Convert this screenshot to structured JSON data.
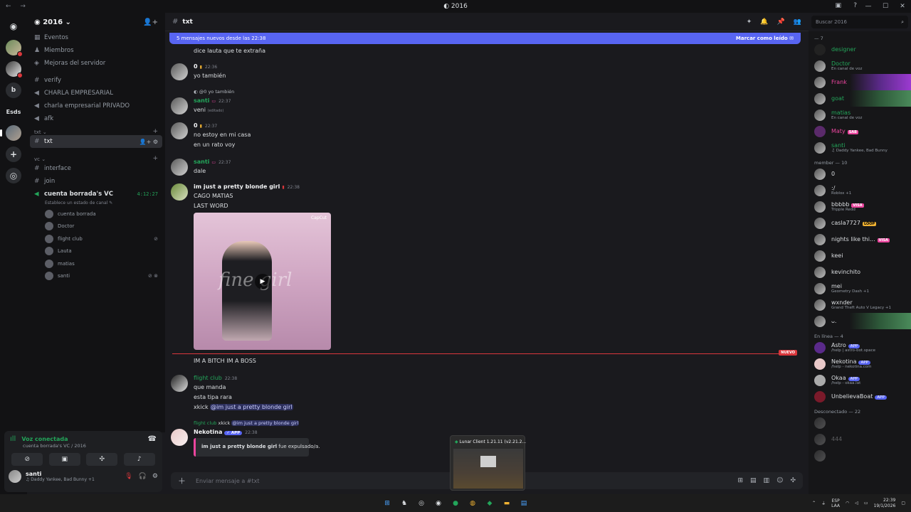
{
  "window": {
    "title": "2016",
    "nav_back": "←",
    "nav_forward": "→",
    "controls": [
      "—",
      "☐",
      "✕"
    ]
  },
  "servers": {
    "discord_glyph": "◉",
    "items": [
      {
        "label": "",
        "type": "av1"
      },
      {
        "label": "",
        "type": "av2"
      },
      {
        "label": "b",
        "type": "plain"
      },
      {
        "label": "Esds",
        "type": "txt"
      },
      {
        "label": "",
        "type": "av3"
      },
      {
        "label": "+",
        "type": "add"
      },
      {
        "label": "◎",
        "type": "add"
      }
    ]
  },
  "sidebar": {
    "server_name": "2016",
    "top_items": [
      "Eventos",
      "Miembros",
      "Mejoras del servidor"
    ],
    "channels_a": [
      "verify",
      "CHARLA EMPRESARIAL",
      "charla empresarial PRIVADO",
      "afk"
    ],
    "cat_txt": "txt",
    "active_channel": "txt",
    "cat_vc": "vc",
    "voice_channels": [
      "interface",
      "join"
    ],
    "vc_active": {
      "name": "cuenta borrada's VC",
      "time": "4:12:27",
      "status": "Establece un estado de canal ✎"
    },
    "vc_users": [
      "cuenta borrada",
      "Doctor",
      "flight club",
      "Lauta",
      "matias",
      "santi"
    ]
  },
  "voice_panel": {
    "title": "Voz conectada",
    "sub": "cuenta borrada's VC / 2016",
    "user_name": "santi",
    "user_status": "♫ Daddy Yankee, Bad Bunny +1"
  },
  "chat": {
    "channel": "txt",
    "new_messages": "5 mensajes nuevos desde las 22:38",
    "mark_read": "Marcar como leído",
    "composer_placeholder": "Enviar mensaje a #txt",
    "messages": {
      "m0_line": "dice lauta que te extraña",
      "m1_name": "0",
      "m1_time": "22:36",
      "m1_line": "yo también",
      "m2_reply": "@0 yo también",
      "m2_name": "santi",
      "m2_time": "22:37",
      "m2_line": "veni",
      "m2_edited": "(editado)",
      "m3_name": "0",
      "m3_time": "22:37",
      "m3_line1": "no estoy en mi casa",
      "m3_line2": "en un rato voy",
      "m4_name": "santi",
      "m4_time": "22:37",
      "m4_line": "dale",
      "m5_name": "im just a pretty blonde girl",
      "m5_time": "22:38",
      "m5_line1": "CAGO MATIAS",
      "m5_line2": "LAST WORD",
      "media_watermark": "fine girl",
      "media_caption": "CapCut",
      "m6_line": "IM A BITCH IM A BOSS",
      "new_label": "NUEVO",
      "m7_name": "flight club",
      "m7_time": "22:38",
      "m7_line1": "que manda",
      "m7_line2": "esta tipa rara",
      "m7_line3": "xkick",
      "m7_mention": "@im just a pretty blonde girl",
      "m8_reply_user": "flight club",
      "m8_reply_cmd": "xkick",
      "m8_reply_mention": "@im just a pretty blonde girl",
      "m8_name": "Nekotina",
      "m8_app": "APP",
      "m8_time": "22:38",
      "m8_embed_bold": "im just a pretty blonde girl",
      "m8_embed_rest": "fue expulsado/a."
    }
  },
  "popup": {
    "title": "Lunar Client 1.21.11 (v2.21.2..."
  },
  "members": {
    "search": "Buscar 2016",
    "group_top": "— 7",
    "top": [
      {
        "name": "designer",
        "color": "#23a55a",
        "sub": ""
      },
      {
        "name": "Doctor",
        "color": "#23a55a",
        "sub": "En canal de voz"
      },
      {
        "name": "Frank",
        "color": "#eb459e",
        "sub": ""
      },
      {
        "name": "goat",
        "color": "#23a55a",
        "sub": ""
      },
      {
        "name": "matias",
        "color": "#23a55a",
        "sub": "En canal de voz"
      },
      {
        "name": "Maty",
        "color": "#eb459e",
        "sub": "",
        "tag": "SAB"
      },
      {
        "name": "santi",
        "color": "#23a55a",
        "sub": "Daddy Yankee, Bad Bunny"
      }
    ],
    "group_member": "member — 10",
    "member": [
      {
        "name": "0",
        "sub": ""
      },
      {
        "name": ":/",
        "sub": "Roblox +1"
      },
      {
        "name": "bbbbb",
        "sub": "Tripple Redd",
        "tag": "VISA"
      },
      {
        "name": "casla7727",
        "sub": "",
        "tag": "LOOP"
      },
      {
        "name": "nights like thi...",
        "sub": "",
        "tag": "VISA"
      },
      {
        "name": "keei",
        "sub": ""
      },
      {
        "name": "kevinchito",
        "sub": ""
      },
      {
        "name": "mei",
        "sub": "Geometry Dash +1"
      },
      {
        "name": "wxnder",
        "sub": "Grand Theft Auto V Legacy +1"
      },
      {
        "name": "ᴗ.",
        "sub": ""
      }
    ],
    "group_online": "En línea — 4",
    "online": [
      {
        "name": "Astro",
        "sub": "/help | astro-bot.space"
      },
      {
        "name": "Nekotina",
        "sub": "/help - nekotina.com"
      },
      {
        "name": "Okaa",
        "sub": "/help - okaa.lat"
      },
      {
        "name": "UnbelievaBoat",
        "sub": ""
      }
    ],
    "app_tag": "APP",
    "group_offline": "Desconectado — 22",
    "offline": [
      "",
      "444",
      ""
    ]
  },
  "taskbar": {
    "lang1": "ESP",
    "lang2": "LAA",
    "time": "22:39",
    "date": "19/1/2026"
  }
}
